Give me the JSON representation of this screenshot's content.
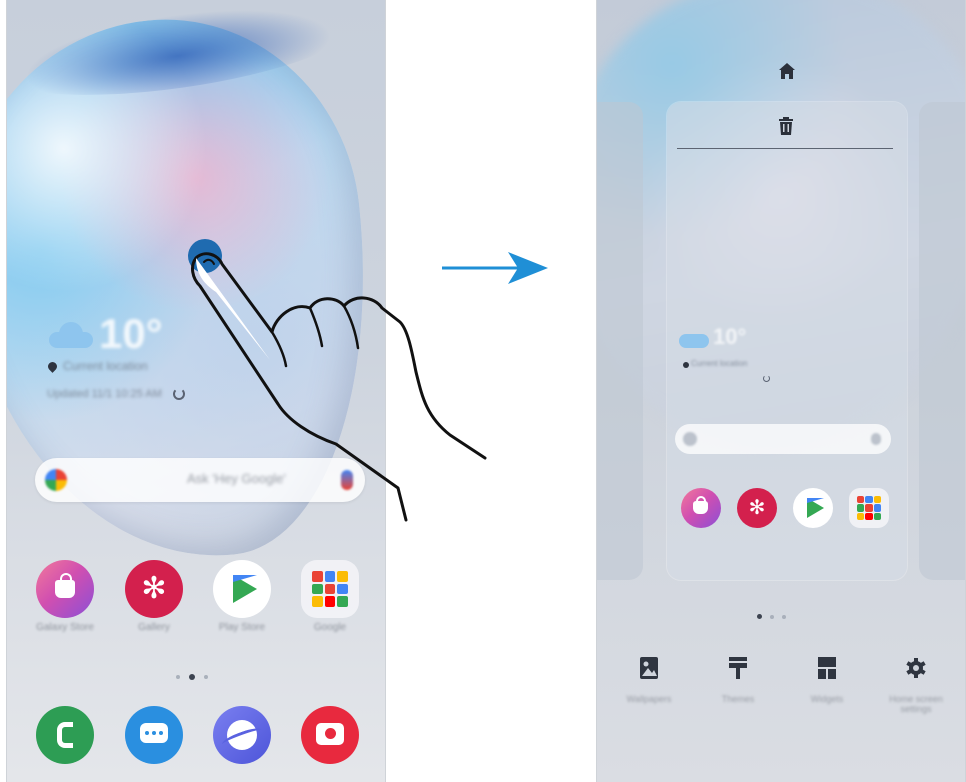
{
  "left_screen": {
    "weather": {
      "temperature": "10°",
      "location": "Current location",
      "updated": "Updated 11/1 10:25 AM"
    },
    "search": {
      "placeholder": "Ask 'Hey Google'"
    },
    "apps": [
      {
        "label": "Galaxy Store",
        "icon": "store-bag-icon"
      },
      {
        "label": "Gallery",
        "icon": "flower-icon"
      },
      {
        "label": "Play Store",
        "icon": "play-store-icon"
      },
      {
        "label": "Google",
        "icon": "folder-icon"
      }
    ],
    "page_indicator": {
      "pages": 3,
      "current": 2
    },
    "dock": [
      {
        "label": "Phone",
        "icon": "phone-icon"
      },
      {
        "label": "Messages",
        "icon": "messages-icon"
      },
      {
        "label": "Internet",
        "icon": "browser-icon"
      },
      {
        "label": "Camera",
        "icon": "camera-icon"
      }
    ]
  },
  "right_screen": {
    "top_icons": [
      "home-icon",
      "trash-icon"
    ],
    "weather": {
      "temperature": "10°",
      "location": "Current location"
    },
    "apps": [
      "store-bag-icon",
      "flower-icon",
      "play-store-icon",
      "folder-icon"
    ],
    "page_indicator": {
      "pages": 3,
      "current": 1
    },
    "toolbar": [
      {
        "label": "Wallpapers",
        "icon": "wallpapers-icon"
      },
      {
        "label": "Themes",
        "icon": "themes-icon"
      },
      {
        "label": "Widgets",
        "icon": "widgets-icon"
      },
      {
        "label": "Home screen settings",
        "icon": "settings-gear-icon"
      }
    ]
  },
  "colors": {
    "touch_point": "#1f6bb0",
    "arrow": "#1f8fd6",
    "gallery_red": "#d3204d",
    "phone_green": "#2d9d54",
    "messages_blue": "#2a8fe0",
    "camera_red": "#e8293e"
  }
}
